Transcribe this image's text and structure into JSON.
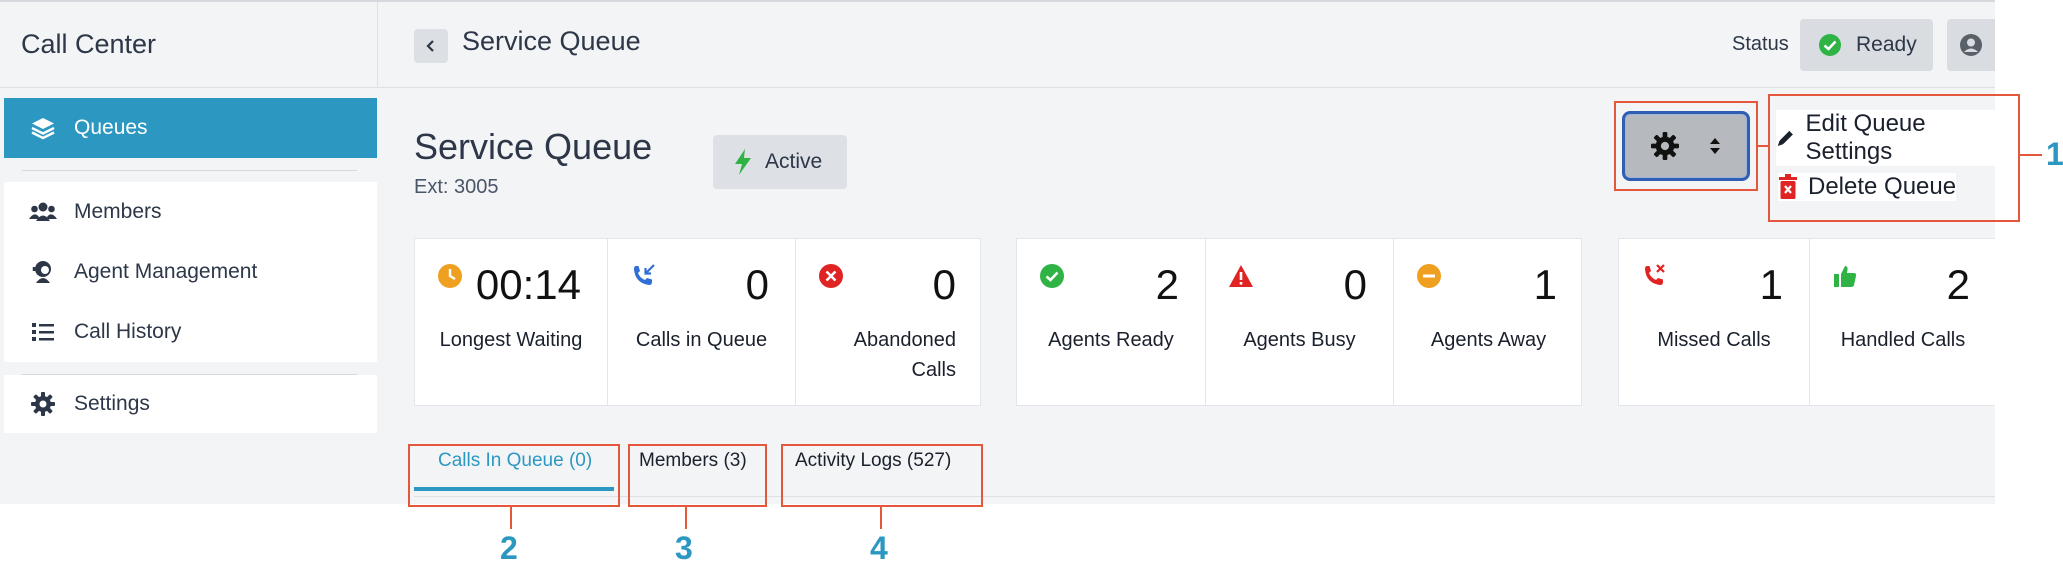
{
  "app": {
    "brand": "Call Center"
  },
  "header": {
    "title": "Service Queue",
    "status_label": "Status",
    "status_value": "Ready"
  },
  "sidebar": {
    "items": [
      {
        "label": "Queues",
        "icon": "layers-icon",
        "active": true
      },
      {
        "label": "Members",
        "icon": "users-icon"
      },
      {
        "label": "Agent Management",
        "icon": "agent-icon"
      },
      {
        "label": "Call History",
        "icon": "list-icon"
      },
      {
        "label": "Settings",
        "icon": "gear-icon"
      }
    ]
  },
  "queue": {
    "title": "Service Queue",
    "ext": "Ext: 3005",
    "status": "Active"
  },
  "settings_menu": {
    "edit": "Edit Queue Settings",
    "delete": "Delete Queue"
  },
  "stats": {
    "longest_waiting": {
      "value": "00:14",
      "label": "Longest Waiting",
      "color": "#f0a020"
    },
    "calls_in_queue": {
      "value": "0",
      "label": "Calls in Queue",
      "color": "#2f6fd6"
    },
    "abandoned_calls": {
      "value": "0",
      "label_line1": "Abandoned",
      "label_line2": "Calls",
      "color": "#e02424"
    },
    "agents_ready": {
      "value": "2",
      "label": "Agents Ready",
      "color": "#2fb344"
    },
    "agents_busy": {
      "value": "0",
      "label": "Agents Busy",
      "color": "#e02424"
    },
    "agents_away": {
      "value": "1",
      "label": "Agents Away",
      "color": "#f0a020"
    },
    "missed_calls": {
      "value": "1",
      "label": "Missed Calls",
      "color": "#e02424"
    },
    "handled_calls": {
      "value": "2",
      "label": "Handled Calls",
      "color": "#2fb344"
    }
  },
  "tabs": [
    {
      "label": "Calls In Queue (0)",
      "active": true
    },
    {
      "label": "Members (3)"
    },
    {
      "label": "Activity Logs (527)"
    }
  ],
  "callouts": [
    "1",
    "2",
    "3",
    "4"
  ],
  "colors": {
    "accent": "#2c98c2",
    "callout": "#e4573d"
  }
}
